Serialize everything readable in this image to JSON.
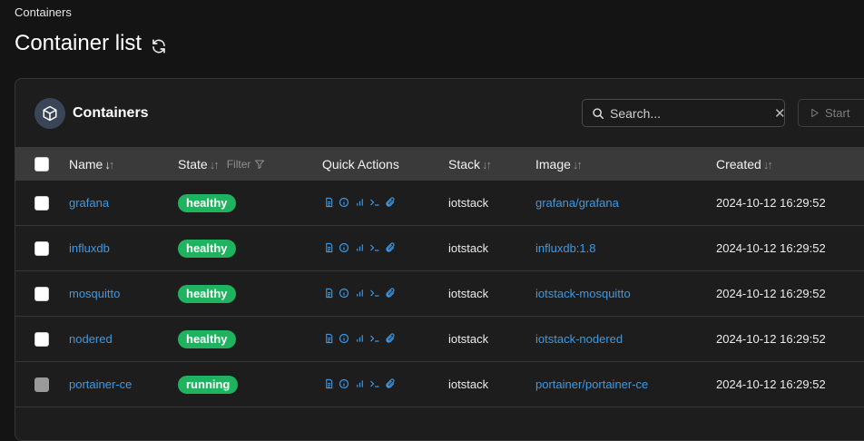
{
  "breadcrumb": "Containers",
  "page": {
    "title": "Container list"
  },
  "panel": {
    "title": "Containers",
    "search_placeholder": "Search...",
    "start_label": "Start"
  },
  "columns": {
    "name": "Name",
    "state": "State",
    "filter": "Filter",
    "quick_actions": "Quick Actions",
    "stack": "Stack",
    "image": "Image",
    "created": "Created"
  },
  "colors": {
    "healthy": "#1fb35f",
    "running": "#1fb35f",
    "link": "#3b9ae8"
  },
  "rows": [
    {
      "name": "grafana",
      "state": "healthy",
      "stack": "iotstack",
      "image": "grafana/grafana",
      "created": "2024-10-12 16:29:52"
    },
    {
      "name": "influxdb",
      "state": "healthy",
      "stack": "iotstack",
      "image": "influxdb:1.8",
      "created": "2024-10-12 16:29:52"
    },
    {
      "name": "mosquitto",
      "state": "healthy",
      "stack": "iotstack",
      "image": "iotstack-mosquitto",
      "created": "2024-10-12 16:29:52"
    },
    {
      "name": "nodered",
      "state": "healthy",
      "stack": "iotstack",
      "image": "iotstack-nodered",
      "created": "2024-10-12 16:29:52"
    },
    {
      "name": "portainer-ce",
      "state": "running",
      "stack": "iotstack",
      "image": "portainer/portainer-ce",
      "created": "2024-10-12 16:29:52"
    }
  ]
}
